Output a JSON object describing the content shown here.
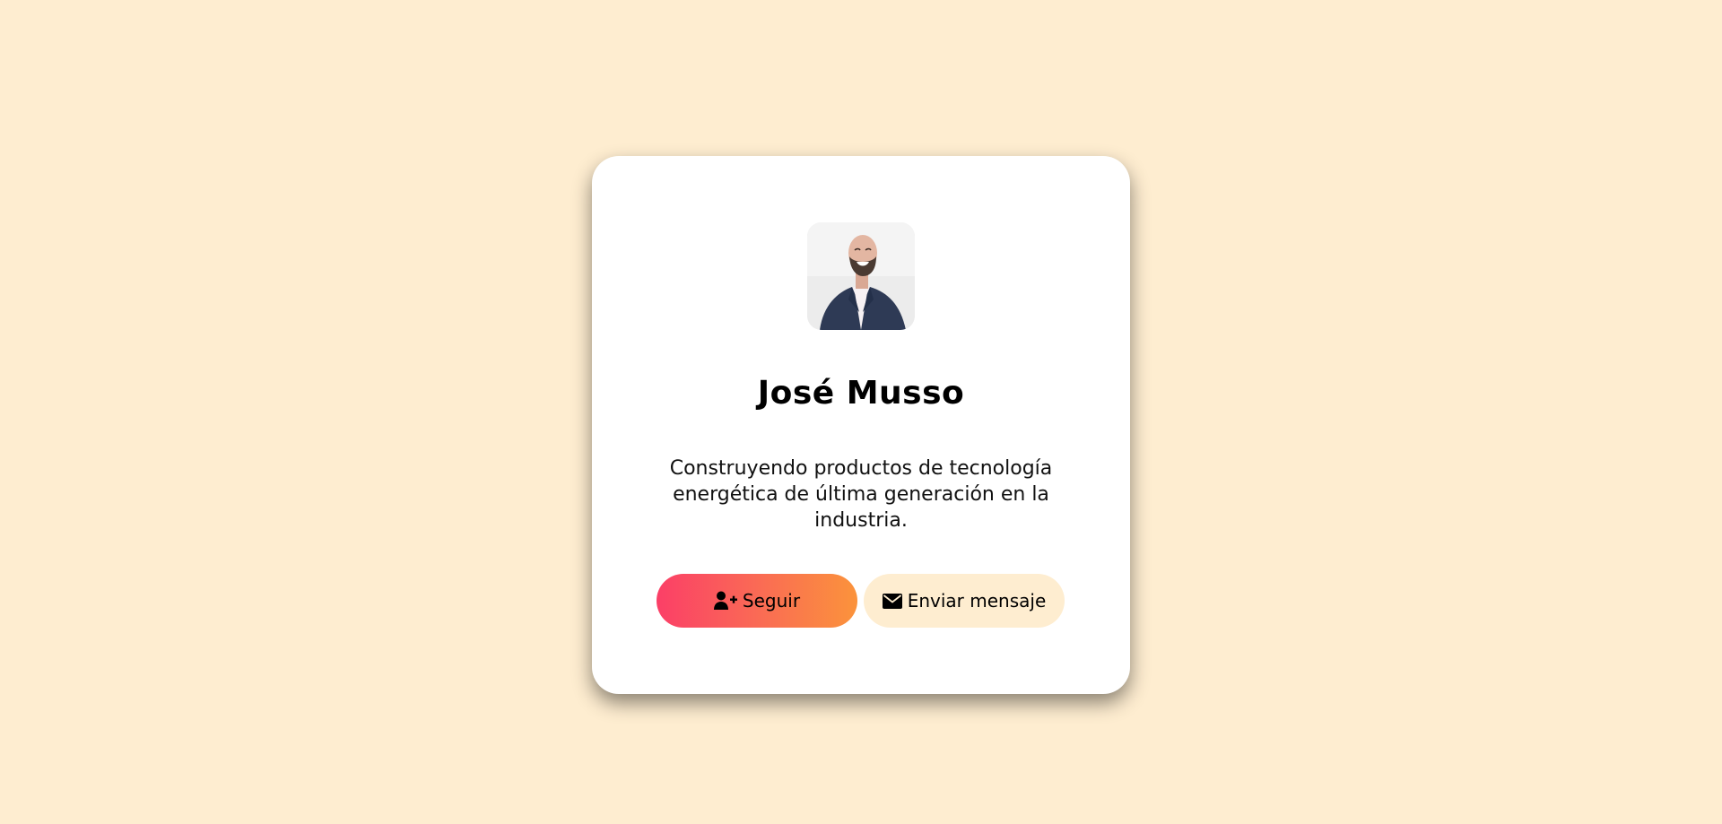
{
  "profile": {
    "avatar_alt": "profile-photo",
    "name": "José Musso",
    "bio": "Construyendo productos de tecnología energética de última generación en la industria."
  },
  "actions": {
    "follow_label": "Seguir",
    "follow_icon": "user-plus-icon",
    "message_label": "Enviar mensaje",
    "message_icon": "envelope-icon"
  },
  "colors": {
    "page_background": "#FEEDD0",
    "card_background": "#FFFFFF",
    "follow_gradient_start": "#FB3F67",
    "follow_gradient_end": "#FB933B",
    "message_button_background": "#FEEDD0"
  }
}
